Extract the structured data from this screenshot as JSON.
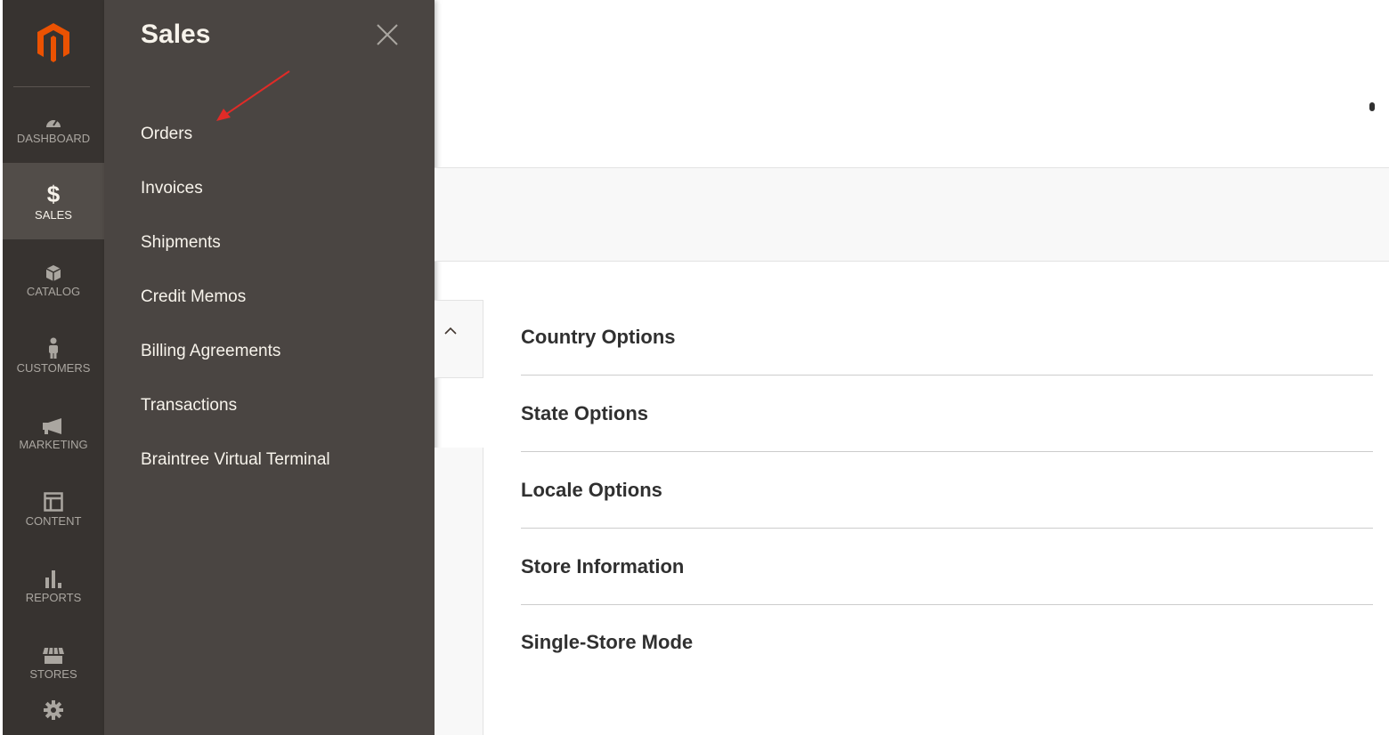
{
  "nav": {
    "items": [
      {
        "key": "dashboard",
        "label": "DASHBOARD",
        "icon": "speedometer-icon"
      },
      {
        "key": "sales",
        "label": "SALES",
        "icon": "dollar-icon",
        "active": true
      },
      {
        "key": "catalog",
        "label": "CATALOG",
        "icon": "box-icon"
      },
      {
        "key": "customers",
        "label": "CUSTOMERS",
        "icon": "person-icon"
      },
      {
        "key": "marketing",
        "label": "MARKETING",
        "icon": "megaphone-icon"
      },
      {
        "key": "content",
        "label": "CONTENT",
        "icon": "layout-icon"
      },
      {
        "key": "reports",
        "label": "REPORTS",
        "icon": "bar-chart-icon"
      },
      {
        "key": "stores",
        "label": "STORES",
        "icon": "storefront-icon"
      },
      {
        "key": "system",
        "label": "",
        "icon": "gear-icon"
      }
    ]
  },
  "flyout": {
    "title": "Sales",
    "items": [
      "Orders",
      "Invoices",
      "Shipments",
      "Credit Memos",
      "Billing Agreements",
      "Transactions",
      "Braintree Virtual Terminal"
    ]
  },
  "content": {
    "sections": [
      "Country Options",
      "State Options",
      "Locale Options",
      "Store Information",
      "Single-Store Mode"
    ]
  },
  "colors": {
    "nav_bg": "#373330",
    "flyout_bg": "#4a4542",
    "brand_orange": "#eb5202",
    "annotation_red": "#e02b27"
  }
}
